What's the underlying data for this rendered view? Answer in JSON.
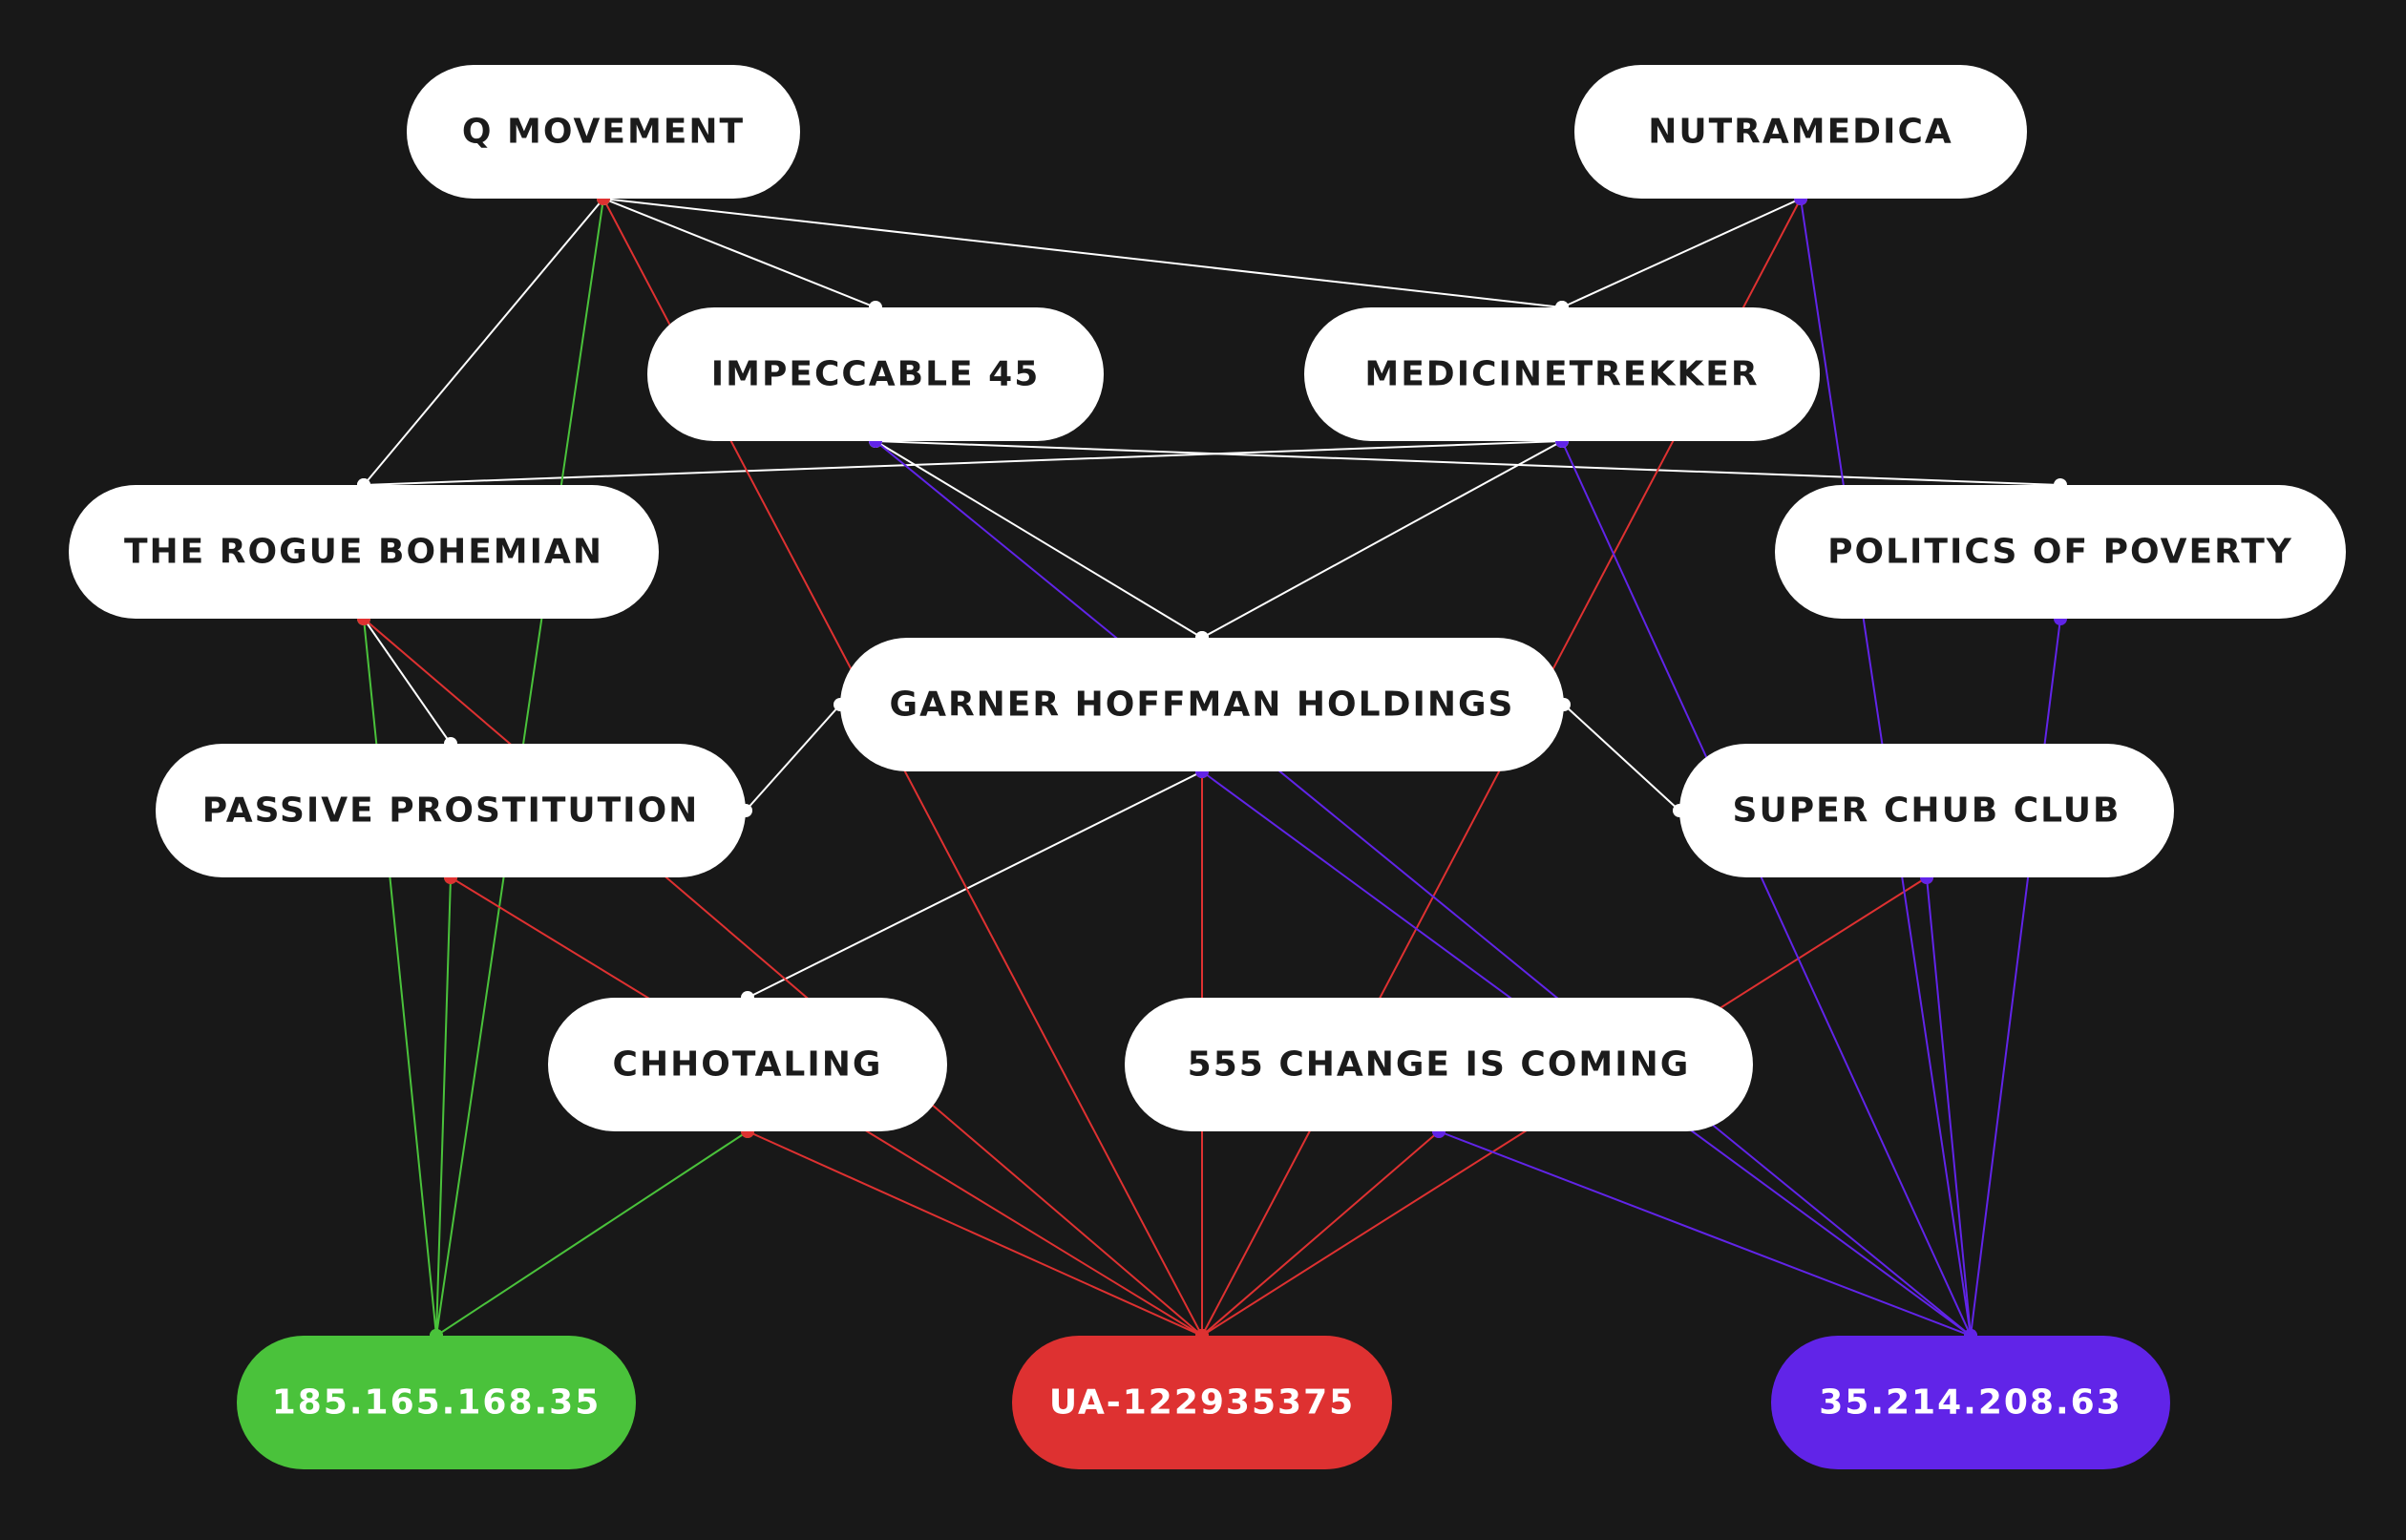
{
  "colors": {
    "background": "#181818",
    "node_fill": "#ffffff",
    "node_text": "#1b1b1b",
    "white_edge": "#ffffff",
    "green": "#4ac23b",
    "red": "#de3131",
    "purple": "#6124e8"
  },
  "nodes": [
    {
      "id": "q",
      "label": "Q MOVEMENT",
      "kind": "entity"
    },
    {
      "id": "nutra",
      "label": "NUTRAMEDICA",
      "kind": "entity"
    },
    {
      "id": "imp",
      "label": "IMPECCABLE 45",
      "kind": "entity"
    },
    {
      "id": "med",
      "label": "MEDICINETREKKER",
      "kind": "entity"
    },
    {
      "id": "rogue",
      "label": "THE ROGUE BOHEMIAN",
      "kind": "entity"
    },
    {
      "id": "pol",
      "label": "POLITICS OF POVERTY",
      "kind": "entity"
    },
    {
      "id": "garner",
      "label": "GARNER HOFFMAN HOLDINGS",
      "kind": "entity"
    },
    {
      "id": "passive",
      "label": "PASSIVE PROSTITUTION",
      "kind": "entity"
    },
    {
      "id": "super",
      "label": "SUPER CHUB CLUB",
      "kind": "entity"
    },
    {
      "id": "chho",
      "label": "CHHOTALING",
      "kind": "entity"
    },
    {
      "id": "c555",
      "label": "555 CHANGE IS COMING",
      "kind": "entity"
    },
    {
      "id": "ip1",
      "label": "185.165.168.35",
      "kind": "ip-green"
    },
    {
      "id": "ua",
      "label": "UA-122935375",
      "kind": "analytics-red"
    },
    {
      "id": "ip2",
      "label": "35.214.208.63",
      "kind": "ip-purple"
    }
  ],
  "edges": [
    {
      "from": "q",
      "to": "med",
      "color": "white"
    },
    {
      "from": "q",
      "to": "imp",
      "color": "white"
    },
    {
      "from": "q",
      "to": "rogue",
      "color": "white"
    },
    {
      "from": "nutra",
      "to": "med",
      "color": "white"
    },
    {
      "from": "imp",
      "to": "pol",
      "color": "white"
    },
    {
      "from": "imp",
      "to": "garner",
      "color": "white"
    },
    {
      "from": "med",
      "to": "rogue",
      "color": "white"
    },
    {
      "from": "med",
      "to": "garner",
      "color": "white"
    },
    {
      "from": "rogue",
      "to": "passive",
      "color": "white"
    },
    {
      "from": "garner",
      "to": "passive",
      "color": "white"
    },
    {
      "from": "garner",
      "to": "super",
      "color": "white"
    },
    {
      "from": "garner",
      "to": "chho",
      "color": "white"
    },
    {
      "from": "q",
      "to": "ip1",
      "color": "green"
    },
    {
      "from": "rogue",
      "to": "ip1",
      "color": "green"
    },
    {
      "from": "passive",
      "to": "ip1",
      "color": "green"
    },
    {
      "from": "chho",
      "to": "ip1",
      "color": "green"
    },
    {
      "from": "q",
      "to": "ua",
      "color": "red"
    },
    {
      "from": "nutra",
      "to": "ua",
      "color": "red"
    },
    {
      "from": "rogue",
      "to": "ua",
      "color": "red"
    },
    {
      "from": "passive",
      "to": "ua",
      "color": "red"
    },
    {
      "from": "garner",
      "to": "ua",
      "color": "red"
    },
    {
      "from": "super",
      "to": "ua",
      "color": "red"
    },
    {
      "from": "chho",
      "to": "ua",
      "color": "red"
    },
    {
      "from": "c555",
      "to": "ua",
      "color": "red"
    },
    {
      "from": "nutra",
      "to": "ip2",
      "color": "purple"
    },
    {
      "from": "imp",
      "to": "ip2",
      "color": "purple"
    },
    {
      "from": "med",
      "to": "ip2",
      "color": "purple"
    },
    {
      "from": "pol",
      "to": "ip2",
      "color": "purple"
    },
    {
      "from": "garner",
      "to": "ip2",
      "color": "purple"
    },
    {
      "from": "super",
      "to": "ip2",
      "color": "purple"
    },
    {
      "from": "c555",
      "to": "ip2",
      "color": "purple"
    }
  ]
}
